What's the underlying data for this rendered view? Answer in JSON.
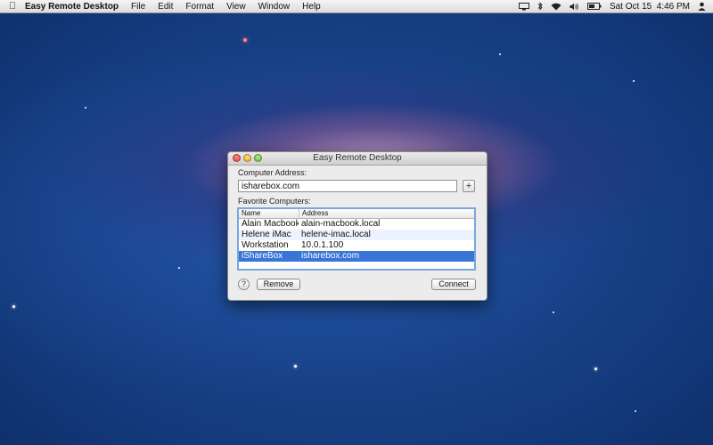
{
  "menubar": {
    "apple_icon": "apple-icon",
    "app_name": "Easy Remote Desktop",
    "items": [
      "File",
      "Edit",
      "Format",
      "View",
      "Window",
      "Help"
    ],
    "clock": "Sat Oct 15  4:46 PM"
  },
  "window": {
    "title": "Easy Remote Desktop",
    "computer_address_label": "Computer Address:",
    "address_value": "isharebox.com",
    "add_button_label": "+",
    "favorites_label": "Favorite Computers:",
    "columns": [
      "Name",
      "Address"
    ],
    "rows": [
      {
        "name": "Alain Macbook",
        "address": "alain-macbook.local"
      },
      {
        "name": "Helene iMac",
        "address": "helene-imac.local"
      },
      {
        "name": "Workstation",
        "address": "10.0.1.100"
      },
      {
        "name": "iShareBox",
        "address": "isharebox.com"
      }
    ],
    "selected_row": 3,
    "help_label": "?",
    "remove_label": "Remove",
    "connect_label": "Connect"
  },
  "colors": {
    "selection": "#3875d7",
    "focus_ring": "#7aa6df"
  }
}
